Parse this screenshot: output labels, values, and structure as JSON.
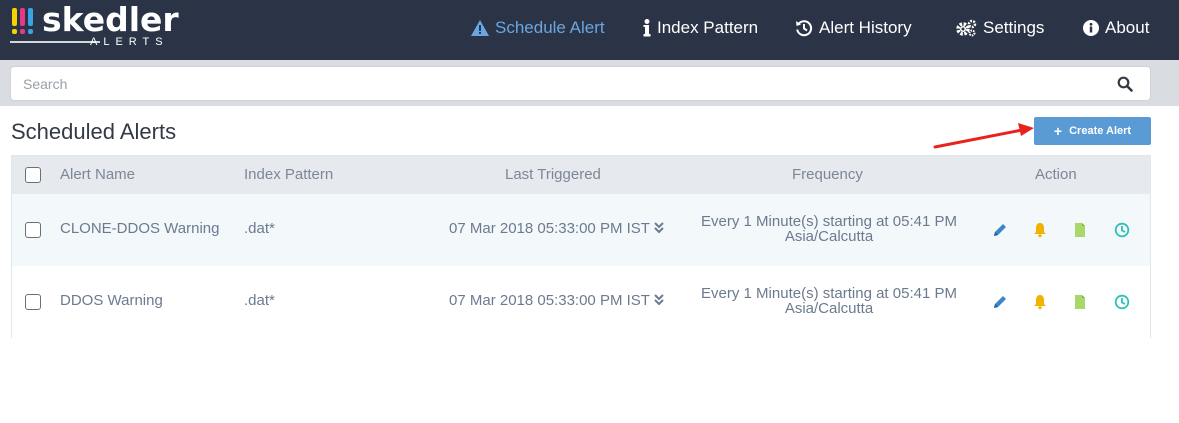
{
  "brand": {
    "name": "skedler",
    "sub": "ALERTS"
  },
  "nav": {
    "schedule_alert": "Schedule Alert",
    "index_pattern": "Index Pattern",
    "alert_history": "Alert History",
    "settings": "Settings",
    "about": "About"
  },
  "search": {
    "placeholder": "Search",
    "value": ""
  },
  "page": {
    "title": "Scheduled Alerts",
    "create_button": "Create Alert"
  },
  "table": {
    "headers": [
      "Alert Name",
      "Index Pattern",
      "Last Triggered",
      "Frequency",
      "Action"
    ],
    "rows": [
      {
        "name": "CLONE-DDOS Warning",
        "index_pattern": ".dat*",
        "last_triggered": "07 Mar 2018 05:33:00 PM IST",
        "frequency_line1": "Every 1 Minute(s) starting at 05:41 PM",
        "frequency_line2": "Asia/Calcutta"
      },
      {
        "name": "DDOS Warning",
        "index_pattern": ".dat*",
        "last_triggered": "07 Mar 2018 05:33:00 PM IST",
        "frequency_line1": "Every 1 Minute(s) starting at 05:41 PM",
        "frequency_line2": "Asia/Calcutta"
      }
    ]
  },
  "icons": {
    "nav": [
      "warning-icon",
      "info-icon",
      "history-icon",
      "gears-icon",
      "info-circle-icon"
    ],
    "actions": [
      "pencil-icon",
      "bell-icon",
      "file-icon",
      "clock-icon"
    ]
  },
  "colors": {
    "navbar": "#2b3346",
    "active_nav": "#6aa6e0",
    "create_button": "#5b9bd5",
    "edit": "#3a86c8",
    "bell": "#f0b400",
    "file": "#a8d86a",
    "clock": "#2cc1b8",
    "arrow": "#e8231f"
  }
}
